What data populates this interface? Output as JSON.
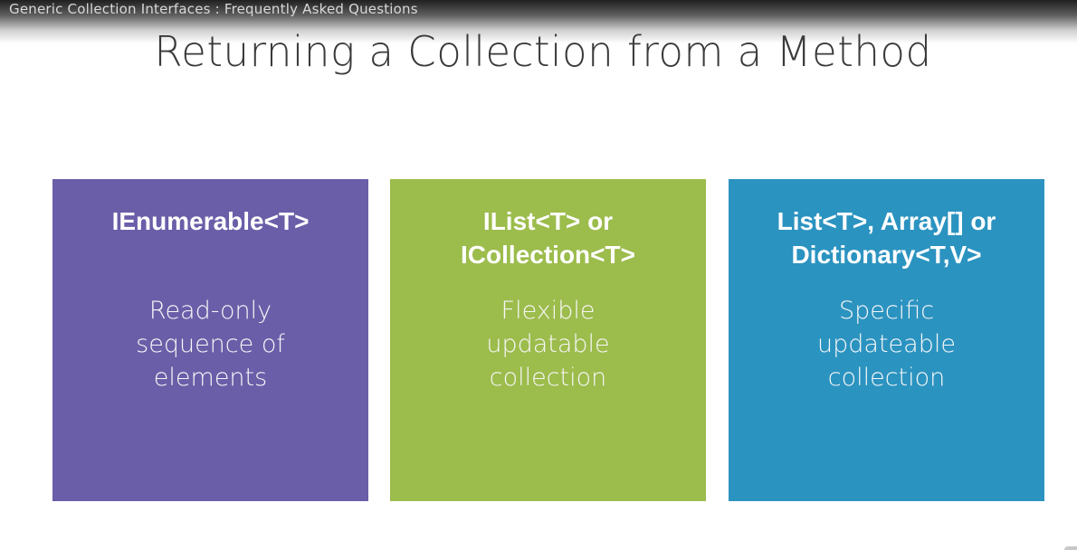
{
  "header": {
    "course_title": "Generic Collection Interfaces : Frequently Asked Questions"
  },
  "slide": {
    "title": "Returning a Collection from a Method"
  },
  "cards": [
    {
      "heading": "IEnumerable<T>",
      "body": "Read-only\nsequence of\nelements",
      "color": "#6a5ea8"
    },
    {
      "heading": "IList<T> or\nICollection<T>",
      "body": "Flexible\nupdatable\ncollection",
      "color": "#9cbc4c"
    },
    {
      "heading": "List<T>, Array[] or\nDictionary<T,V>",
      "body": "Specific\nupdateable\ncollection",
      "color": "#2b93c0"
    }
  ]
}
